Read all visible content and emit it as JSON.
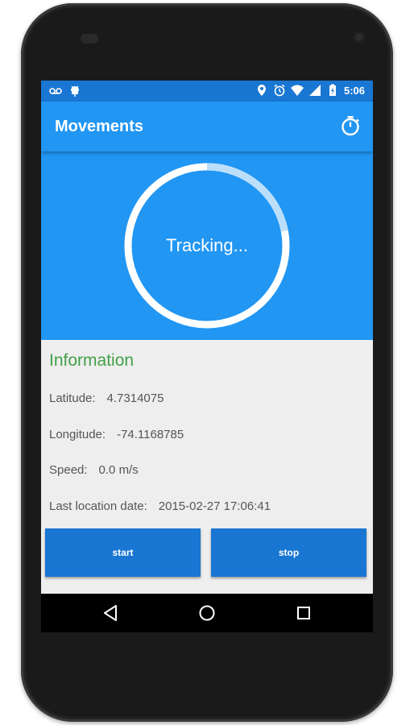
{
  "status_bar": {
    "time": "5:06",
    "icons_left": [
      "voicemail-icon",
      "android-debug-icon"
    ],
    "icons_right": [
      "location-icon",
      "alarm-icon",
      "wifi-icon",
      "signal-icon",
      "battery-charging-icon"
    ]
  },
  "app_bar": {
    "title": "Movements",
    "action_icon": "stopwatch-icon"
  },
  "tracker": {
    "status_text": "Tracking...",
    "progress": 0.22
  },
  "information": {
    "title": "Information",
    "latitude": {
      "label": "Latitude:",
      "value": "4.7314075"
    },
    "longitude": {
      "label": "Longitude:",
      "value": "-74.1168785"
    },
    "speed": {
      "label": "Speed:",
      "value": "0.0 m/s"
    },
    "last_date": {
      "label": "Last location date:",
      "value": "2015-02-27 17:06:41"
    }
  },
  "buttons": {
    "start_label": "start",
    "stop_label": "stop"
  },
  "nav_bar": {
    "back_icon": "back-triangle-icon",
    "home_icon": "home-circle-icon",
    "recents_icon": "recents-square-icon"
  },
  "colors": {
    "primary": "#2196f3",
    "primary_dark": "#1976d2",
    "accent_green": "#43a047",
    "background": "#eeeeee"
  }
}
